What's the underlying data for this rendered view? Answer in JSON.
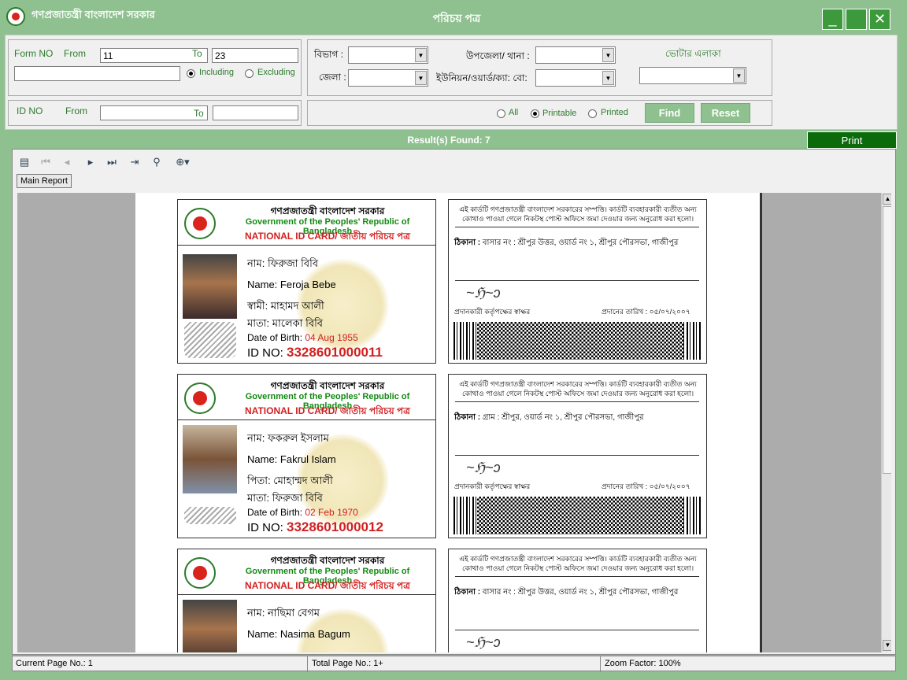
{
  "app": {
    "title": "গণপ্রজাতন্ত্রী বাংলাদেশ সরকার",
    "window_title": "পরিচয় পত্র",
    "min_label": "_",
    "max_label": "",
    "close_label": "✕"
  },
  "filter": {
    "form_no_label": "Form NO",
    "from_label": "From",
    "to_label": "To",
    "form_from": "11",
    "form_to": "23",
    "including_label": "Including",
    "excluding_label": "Excluding",
    "id_no_label": "ID NO",
    "id_from_label": "From",
    "id_to_label": "To",
    "division_label": "বিভাগ :",
    "district_label": "জেলা :",
    "upazila_label": "উপজেলা/ থানা :",
    "union_label": "ইউনিয়ন/ওয়ার্ড/ক্যা: বো:",
    "voter_area_label": "ভোটার এলাকা",
    "all_label": "All",
    "printable_label": "Printable",
    "printed_label": "Printed",
    "find_label": "Find",
    "reset_label": "Reset"
  },
  "results": {
    "found_text": "Result(s) Found: 7",
    "print_label": "Print"
  },
  "viewer": {
    "tab_label": "Main Report",
    "status": {
      "current_page": "Current Page No.: 1",
      "total_page": "Total Page No.: 1+",
      "zoom": "Zoom Factor: 100%"
    }
  },
  "card_common": {
    "gov_bn": "গণপ্রজাতন্ত্রী বাংলাদেশ সরকার",
    "gov_en": "Government of the Peoples' Republic of Bangladesh",
    "nid_title": "NATIONAL ID CARD/ জাতীয় পরিচয় পত্র",
    "back_notice": "এই কার্ডটি গণপ্রজাতন্ত্রী বাংলাদেশ সরকারের সম্পত্তি। কার্ডটি ব্যবহারকারী ব্যতীত অন্য কোথাও পাওয়া গেলে নিকটস্থ পোস্ট অফিসে জমা দেওয়ার জন্য অনুরোধ করা হলো।",
    "address_label": "ঠিকানা :",
    "issuer_sign": "প্রদানকারী কর্তৃপক্ষের স্বাক্ষর",
    "issue_date": "প্রদানের তারিখ : ০৫/০৭/২০০৭",
    "dob_label": "Date of Birth:",
    "id_label": "ID NO:",
    "name_en_label": "Name:"
  },
  "cards": [
    {
      "name_bn": "নাম:  ফিরুজা  বিবি",
      "name_en": "Feroja  Bebe",
      "relative": "স্বামী: মাহামদ আলী",
      "mother": "মাতা: মালেকা  বিবি",
      "dob": "04 Aug 1955",
      "id_no": "3328601000011",
      "address": "বাসার নং : শ্রীপুর উত্তর, ওয়ার্ড নং ১, শ্রীপুর পৌরসভা, গাজীপুর"
    },
    {
      "name_bn": "নাম:  ফকরুল  ইসলাম",
      "name_en": "Fakrul  Islam",
      "relative": "পিতা: মোহাম্মদ আলী",
      "mother": "মাতা: ফিরুজা  বিবি",
      "dob": "02 Feb 1970",
      "id_no": "3328601000012",
      "address": "গ্রাম : শ্রীপুর, ওয়ার্ড নং ১, শ্রীপুর পৌরসভা, গাজীপুর"
    },
    {
      "name_bn": "নাম:  নাছিমা  বেগম",
      "name_en": "Nasima  Bagum",
      "address": "বাসার নং : শ্রীপুর উত্তর, ওয়ার্ড নং ১, শ্রীপুর পৌরসভা, গাজীপুর"
    }
  ]
}
